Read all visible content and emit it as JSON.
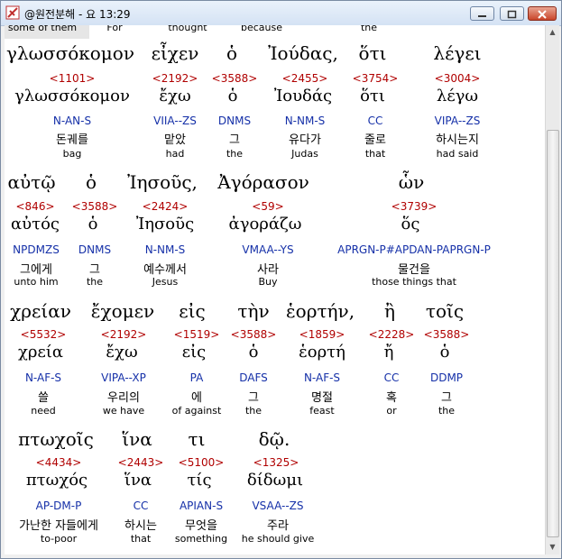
{
  "window": {
    "title": "@원전분해 - 요 13:29"
  },
  "cutoff_row": [
    "some of them",
    "For",
    "thought",
    "because",
    "the"
  ],
  "block1": {
    "greek": [
      "γλωσσόκομον",
      "εἶχεν",
      "ὁ",
      "Ἰούδας,",
      "ὅτι",
      "λέγει"
    ],
    "numbers": [
      "<1101>",
      "<2192>",
      "<3588>",
      "<2455>",
      "<3754>",
      "<3004>"
    ],
    "lemmas": [
      "γλωσσόκομον",
      "ἔχω",
      "ὁ",
      "Ἰουδάς",
      "ὅτι",
      "λέγω"
    ],
    "codes": [
      "N-AN-S",
      "VIIA--ZS",
      "DNMS",
      "N-NM-S",
      "CC",
      "VIPA--ZS"
    ],
    "korean": [
      "돈궤를",
      "맡았",
      "그",
      "유다가",
      "줄로",
      "하시는지"
    ],
    "english": [
      "bag",
      "had",
      "the",
      "Judas",
      "that",
      "had said"
    ]
  },
  "block2": {
    "greek": [
      "αὐτῷ",
      "ὁ",
      "Ἰησοῦς,",
      "Ἀγόρασον",
      "ὧν"
    ],
    "numbers": [
      "<846>",
      "<3588>",
      "<2424>",
      "<59>",
      "<3739>"
    ],
    "lemmas": [
      "αὐτός",
      "ὁ",
      "Ἰησοῦς",
      "ἀγοράζω",
      "ὅς"
    ],
    "codes": [
      "NPDMZS",
      "DNMS",
      "N-NM-S",
      "VMAA--YS",
      "APRGN-P#APDAN-PAPRGN-P"
    ],
    "korean": [
      "그에게",
      "그",
      "예수께서",
      "사라",
      "물건을"
    ],
    "english": [
      "unto him",
      "the",
      "Jesus",
      "Buy",
      "those things that"
    ]
  },
  "block3": {
    "greek": [
      "χρείαν",
      "ἔχομεν",
      "εἰς",
      "τὴν",
      "ἑορτήν,",
      "ἢ",
      "τοῖς"
    ],
    "numbers": [
      "<5532>",
      "<2192>",
      "<1519>",
      "<3588>",
      "<1859>",
      "<2228>",
      "<3588>"
    ],
    "lemmas": [
      "χρεία",
      "ἔχω",
      "εἰς",
      "ὁ",
      "ἑορτή",
      "ἤ",
      "ὁ"
    ],
    "codes": [
      "N-AF-S",
      "VIPA--XP",
      "PA",
      "DAFS",
      "N-AF-S",
      "CC",
      "DDMP"
    ],
    "korean": [
      "쓸",
      "우리의",
      "에",
      "그",
      "명절",
      "혹",
      "그"
    ],
    "english": [
      "need",
      "we have",
      "of against",
      "the",
      "feast",
      "or",
      "the"
    ]
  },
  "block4": {
    "greek": [
      "πτωχοῖς",
      "ἵνα",
      "τι",
      "δῷ."
    ],
    "numbers": [
      "<4434>",
      "<2443>",
      "<5100>",
      "<1325>"
    ],
    "lemmas": [
      "πτωχός",
      "ἵνα",
      "τίς",
      "δίδωμι"
    ],
    "codes": [
      "AP-DM-P",
      "CC",
      "APIAN-S",
      "VSAA--ZS"
    ],
    "korean": [
      "가난한 자들에게",
      "하시는",
      "무엇을",
      "주라"
    ],
    "english": [
      "to-poor",
      "that",
      "something",
      "he should give"
    ]
  }
}
